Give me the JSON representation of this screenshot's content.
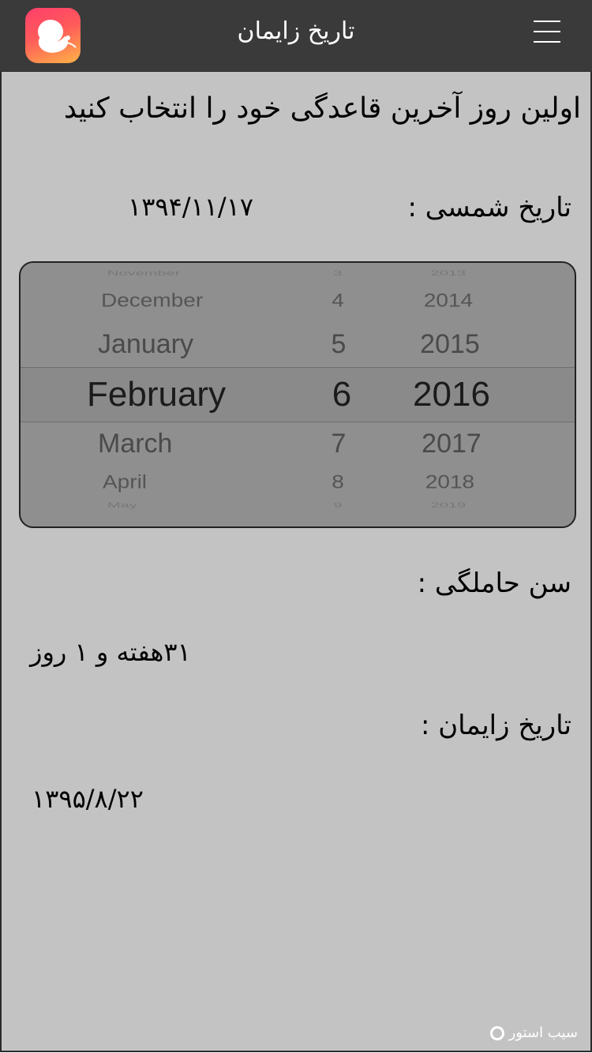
{
  "header": {
    "title": "تاریخ زایمان",
    "app_icon": "embryo-icon",
    "menu_icon": "hamburger-menu-icon",
    "bar_color": "#3a3a3a"
  },
  "main": {
    "heading": "اولین روز آخرین قاعدگی خود را انتخاب کنید",
    "shamsi_label": "تاریخ شمسی :",
    "shamsi_value": "۱۳۹۴/۱۱/۱۷",
    "pregnancy_age_label": "سن حاملگی :",
    "pregnancy_age_value": "۳۱هفته و ۱ روز",
    "due_date_label": "تاریخ زایمان :",
    "due_date_value": "۱۳۹۵/۸/۲۲",
    "background_color": "#c3c3c3"
  },
  "date_picker": {
    "months": [
      "November",
      "December",
      "January",
      "February",
      "March",
      "April",
      "May"
    ],
    "days": [
      "3",
      "4",
      "5",
      "6",
      "7",
      "8",
      "9"
    ],
    "years": [
      "2013",
      "2014",
      "2015",
      "2016",
      "2017",
      "2018",
      "2019"
    ],
    "selected": {
      "month": "February",
      "day": "6",
      "year": "2016"
    }
  },
  "watermark": {
    "text": "سیب استور"
  }
}
